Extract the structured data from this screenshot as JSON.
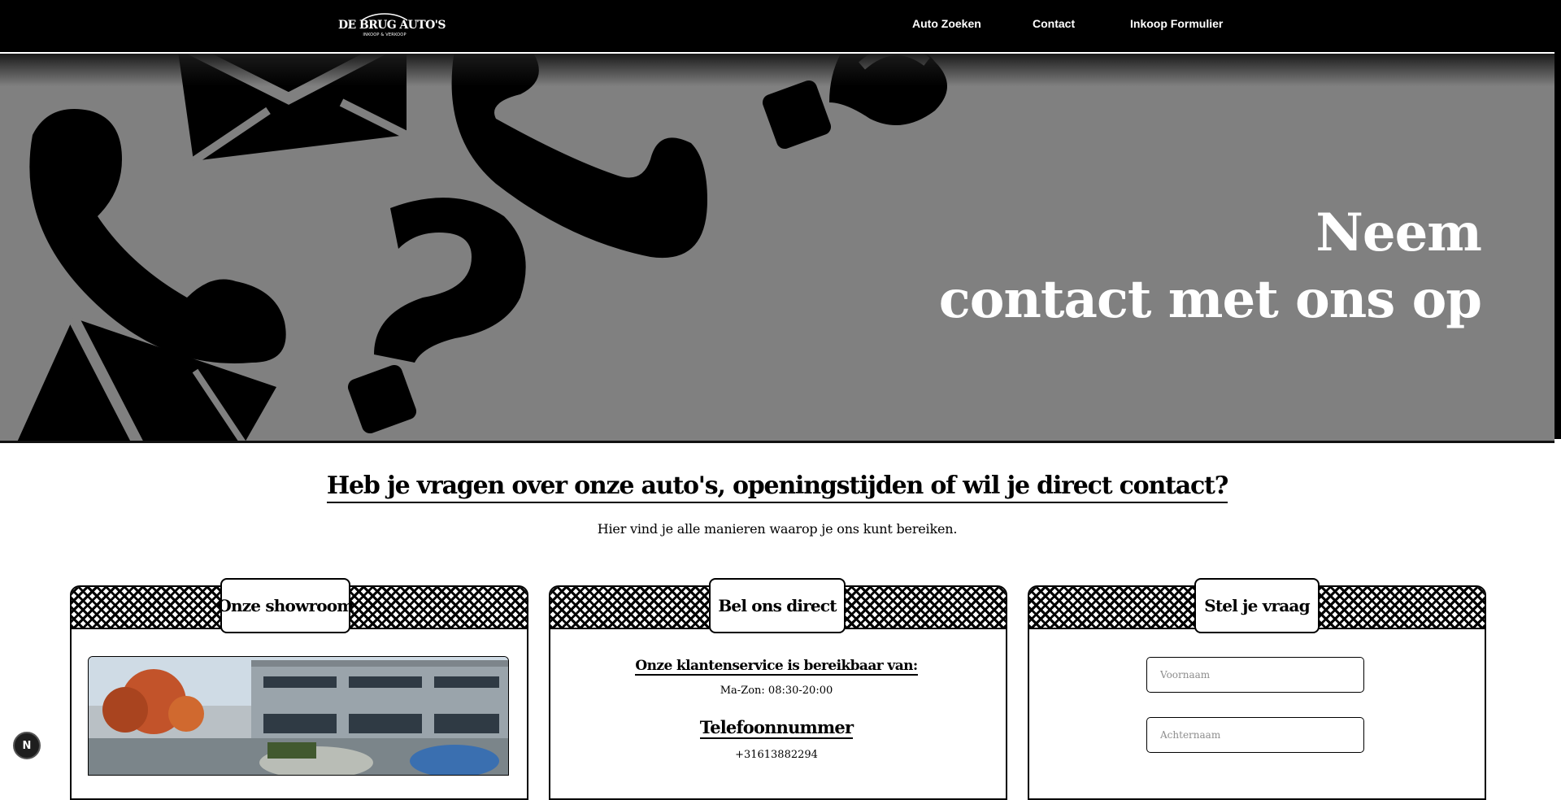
{
  "header": {
    "logo": {
      "main": "DE BRUG AUTO'S",
      "sub": "INKOOP & VERKOOP"
    },
    "nav": [
      "Auto Zoeken",
      "Contact",
      "Inkoop Formulier"
    ]
  },
  "hero": {
    "title_line1": "Neem",
    "title_line2": "contact met ons op"
  },
  "intro": {
    "heading": "Heb je vragen over onze auto's, openingstijden of wil je direct contact?",
    "subtext": "Hier vind je alle manieren waarop je ons kunt bereiken."
  },
  "cards": {
    "showroom": {
      "tab": "Onze showroom"
    },
    "call": {
      "tab": "Bel ons direct",
      "hours_title": "Onze klantenservice is bereikbaar van:",
      "hours": "Ma-Zon: 08:30-20:00",
      "phone_title": "Telefoonnummer",
      "phone": "+31613882294"
    },
    "question": {
      "tab": "Stel je vraag",
      "firstname_placeholder": "Voornaam",
      "lastname_placeholder": "Achternaam"
    }
  },
  "floating": {
    "badge": "N"
  },
  "colors": {
    "nav_bg": "#000000",
    "hero_bg": "#808080",
    "page_bg": "#ffffff",
    "accent": "#000000"
  },
  "icons": [
    "car-logo-icon",
    "envelope-icon",
    "phone-icon",
    "question-mark-icon"
  ]
}
